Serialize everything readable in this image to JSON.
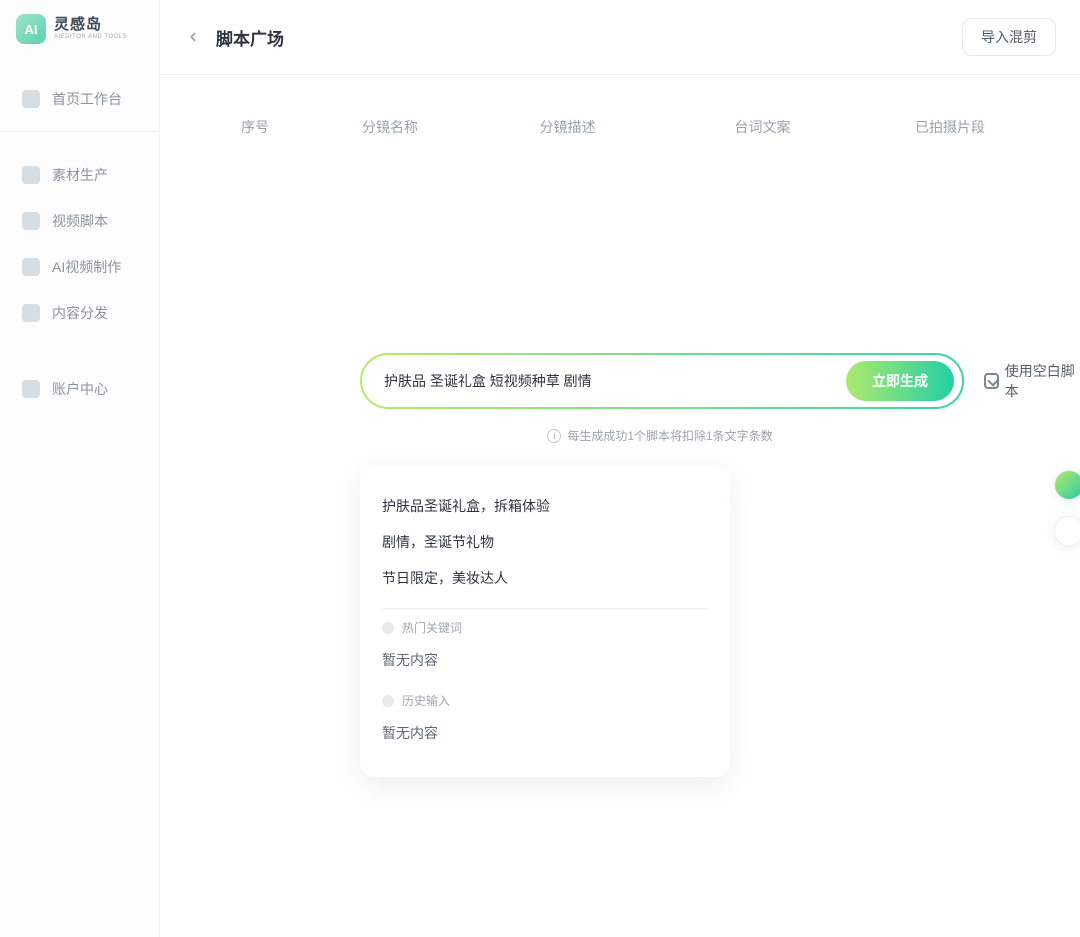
{
  "brand": {
    "badge": "AI",
    "name": "灵感岛",
    "sub": "AIEDITOR AND TOOLS"
  },
  "sidebar": {
    "items": [
      {
        "label": "首页工作台"
      },
      {
        "label": "素材生产"
      },
      {
        "label": "视频脚本"
      },
      {
        "label": "AI视频制作"
      },
      {
        "label": "内容分发"
      },
      {
        "label": "账户中心"
      }
    ]
  },
  "header": {
    "title": "脚本广场",
    "import_btn": "导入混剪"
  },
  "table": {
    "c1": "序号",
    "c2": "分镜名称",
    "c3": "分镜描述",
    "c4": "台词文案",
    "c5": "已拍摄片段"
  },
  "search": {
    "value": "护肤品 圣诞礼盒 短视频种草 剧情",
    "gen_btn": "立即生成",
    "blank_link": "使用空白脚本"
  },
  "hint": {
    "text": "每生成成功1个脚本将扣除1条文字条数"
  },
  "suggestions": {
    "items": [
      "护肤品圣诞礼盒，拆箱体验",
      "剧情，圣诞节礼物",
      "节日限定，美妆达人"
    ],
    "hot_title": "热门关键词",
    "hot_empty": "暂无内容",
    "hist_title": "历史输入",
    "hist_empty": "暂无内容"
  }
}
